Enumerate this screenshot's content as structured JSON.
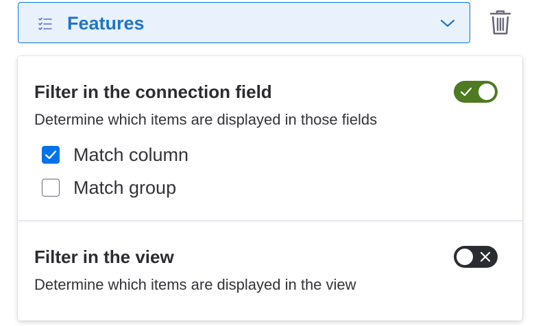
{
  "dropdown": {
    "label": "Features",
    "icon": "checklist-icon",
    "chevron": "chevron-down-icon",
    "accent_color": "#0073ea",
    "label_color": "#1f76c2",
    "background_color": "#e9f1fd"
  },
  "delete_icon": "trash-icon",
  "sections": [
    {
      "title": "Filter in the connection field",
      "description": "Determine which items are displayed in those fields",
      "toggle": {
        "state": "on",
        "color": "#4e7a22",
        "icon": "check-icon"
      },
      "options": [
        {
          "label": "Match column",
          "checked": true
        },
        {
          "label": "Match group",
          "checked": false
        }
      ]
    },
    {
      "title": "Filter in the view",
      "description": "Determine which items are displayed in the view",
      "toggle": {
        "state": "off",
        "color": "#2b2c31",
        "icon": "x-icon"
      }
    }
  ]
}
